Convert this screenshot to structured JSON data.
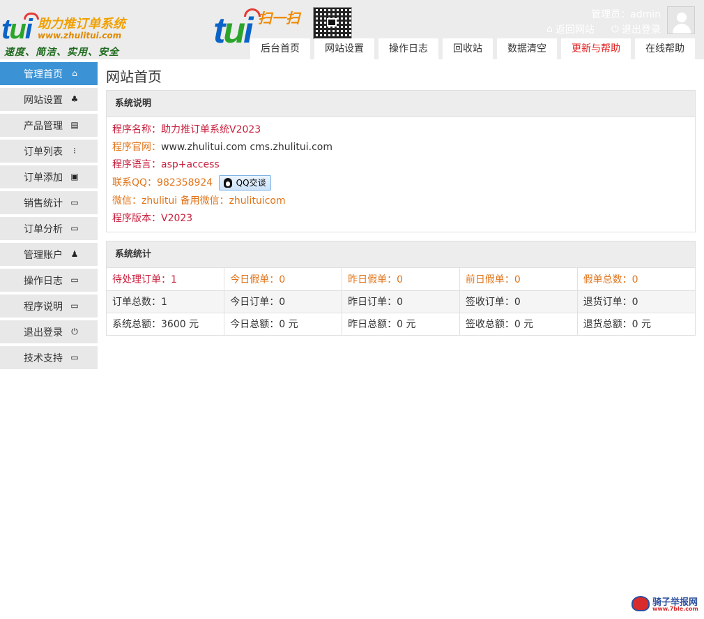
{
  "header": {
    "logo_name": "助力推订单系统",
    "logo_url": "www.zhulitui.com",
    "logo_slogan": "速度、简洁、实用、安全",
    "logo_tui": [
      "t",
      "u",
      "i"
    ],
    "scan_text": "扫一扫",
    "admin_label": "管理员：admin",
    "back_site": "返回网站",
    "logout": "退出登录"
  },
  "topnav": [
    {
      "label": "后台首页",
      "color": "#333333"
    },
    {
      "label": "网站设置",
      "color": "#333333"
    },
    {
      "label": "操作日志",
      "color": "#333333"
    },
    {
      "label": "回收站",
      "color": "#333333"
    },
    {
      "label": "数据清空",
      "color": "#333333"
    },
    {
      "label": "更新与帮助",
      "color": "#e02020"
    },
    {
      "label": "在线帮助",
      "color": "#333333"
    }
  ],
  "sidebar": [
    {
      "label": "管理首页",
      "icon": "home-icon",
      "glyph": "⌂",
      "active": true
    },
    {
      "label": "网站设置",
      "icon": "plug-icon",
      "glyph": "♣"
    },
    {
      "label": "产品管理",
      "icon": "printer-icon",
      "glyph": "▤"
    },
    {
      "label": "订单列表",
      "icon": "tree-icon",
      "glyph": "⁝"
    },
    {
      "label": "订单添加",
      "icon": "document-check-icon",
      "glyph": "▣"
    },
    {
      "label": "销售统计",
      "icon": "window-icon",
      "glyph": "▭"
    },
    {
      "label": "订单分析",
      "icon": "window-icon",
      "glyph": "▭"
    },
    {
      "label": "管理账户",
      "icon": "user-icon",
      "glyph": "♟"
    },
    {
      "label": "操作日志",
      "icon": "window-icon",
      "glyph": "▭"
    },
    {
      "label": "程序说明",
      "icon": "window-icon",
      "glyph": "▭"
    },
    {
      "label": "退出登录",
      "icon": "power-icon",
      "glyph": "⏻"
    },
    {
      "label": "技术支持",
      "icon": "window-icon",
      "glyph": "▭"
    }
  ],
  "main": {
    "title": "网站首页",
    "system_info": {
      "heading": "系统说明",
      "lines": {
        "name_label": "程序名称：",
        "name_value": "助力推订单系统V2023",
        "site_label": "程序官网：",
        "site_value": "www.zhulitui.com cms.zhulitui.com",
        "lang_label": "程序语言：",
        "lang_value": "asp+access",
        "qq_label": "联系QQ：",
        "qq_value": "982358924",
        "qq_button": "QQ交谈",
        "wechat_label": "微信：",
        "wechat_value": "zhulitui 备用微信：zhulituicom",
        "version_label": "程序版本：",
        "version_value": "V2023"
      }
    },
    "stats": {
      "heading": "系统统计",
      "rows": [
        [
          "待处理订单：1",
          "今日假单：0",
          "昨日假单：0",
          "前日假单：0",
          "假单总数：0"
        ],
        [
          "订单总数：1",
          "今日订单：0",
          "昨日订单：0",
          "签收订单：0",
          "退货订单：0"
        ],
        [
          "系统总额：3600 元",
          "今日总额：0 元",
          "昨日总额：0 元",
          "签收总额：0 元",
          "退货总额：0 元"
        ]
      ],
      "row_colors": [
        [
          "#c81e3c",
          "#e0741a",
          "#e0741a",
          "#e0741a",
          "#e0741a"
        ],
        [
          "#333333",
          "#333333",
          "#333333",
          "#333333",
          "#333333"
        ],
        [
          "#333333",
          "#333333",
          "#333333",
          "#333333",
          "#333333"
        ]
      ]
    }
  },
  "footer": {
    "watermark_title": "骑子举报网",
    "watermark_url": "www.7ble.com"
  },
  "colors": {
    "accent": "#3b93d6",
    "header_bg": "#ececec",
    "sidebar_bg": "#e8e8e8",
    "label_red": "#c81e3c",
    "label_orange": "#e0741a"
  }
}
